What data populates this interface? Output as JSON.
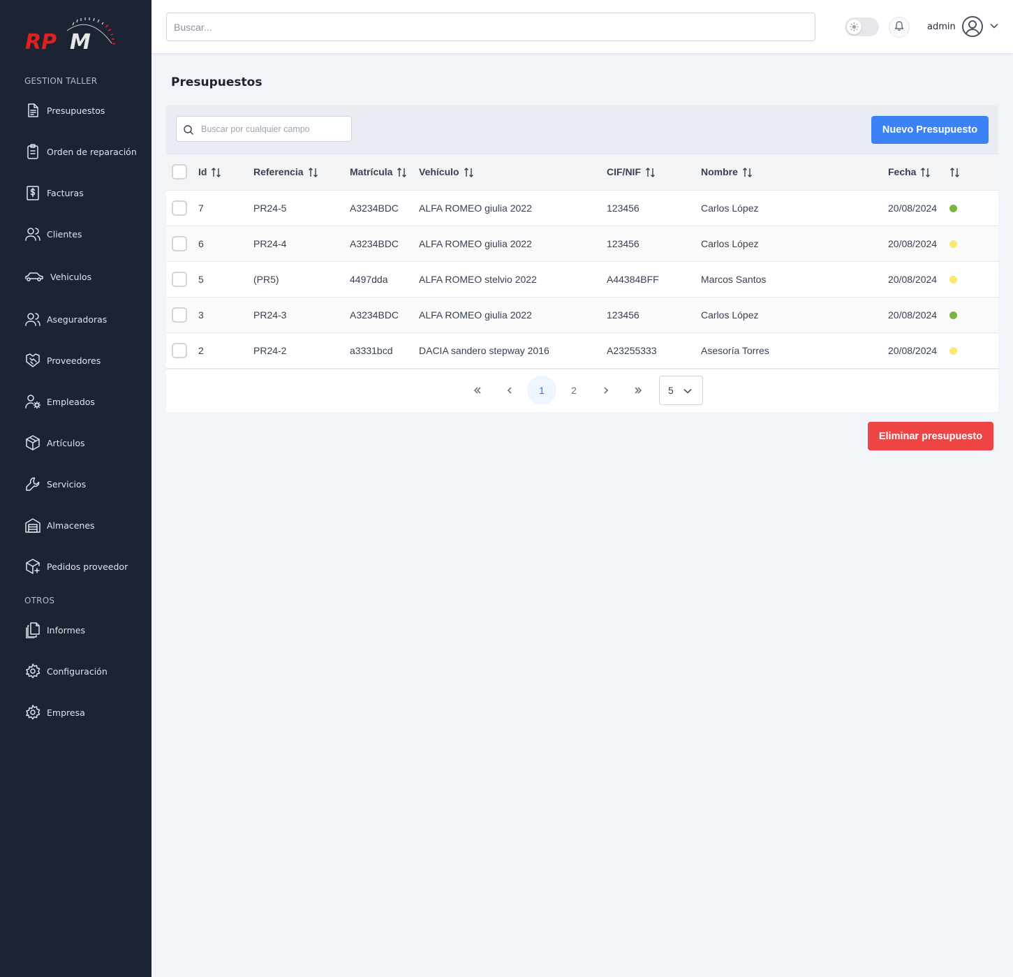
{
  "sidebar": {
    "logo_text": "RPM",
    "sections": [
      {
        "title": "GESTION TALLER",
        "items": [
          {
            "label": "Presupuestos",
            "icon": "document-icon"
          },
          {
            "label": "Orden de reparación",
            "icon": "clipboard-icon"
          },
          {
            "label": "Facturas",
            "icon": "invoice-icon"
          },
          {
            "label": "Clientes",
            "icon": "users-icon"
          },
          {
            "label": "Vehiculos",
            "icon": "car-icon"
          },
          {
            "label": "Aseguradoras",
            "icon": "users-icon"
          },
          {
            "label": "Proveedores",
            "icon": "handshake-icon"
          },
          {
            "label": "Empleados",
            "icon": "user-gear-icon"
          },
          {
            "label": "Artículos",
            "icon": "box-icon"
          },
          {
            "label": "Servicios",
            "icon": "wrench-icon"
          },
          {
            "label": "Almacenes",
            "icon": "warehouse-icon"
          },
          {
            "label": "Pedidos proveedor",
            "icon": "package-add-icon"
          }
        ]
      },
      {
        "title": "OTROS",
        "items": [
          {
            "label": "Informes",
            "icon": "reports-icon"
          },
          {
            "label": "Configuración",
            "icon": "gear-icon"
          },
          {
            "label": "Empresa",
            "icon": "gear-icon"
          }
        ]
      }
    ]
  },
  "header": {
    "search_placeholder": "Buscar...",
    "user_name": "admin"
  },
  "page": {
    "title": "Presupuestos",
    "filter_placeholder": "Buscar por cualquier campo",
    "new_button": "Nuevo Presupuesto",
    "delete_button": "Eliminar presupuesto"
  },
  "table": {
    "columns": [
      "Id",
      "Referencia",
      "Matrícula",
      "Vehículo",
      "CIF/NIF",
      "Nombre",
      "Fecha",
      ""
    ],
    "rows": [
      {
        "id": "7",
        "ref": "PR24-5",
        "plate": "A3234BDC",
        "vehicle": "ALFA ROMEO giulia 2022",
        "cif": "123456",
        "name": "Carlos López",
        "date": "20/08/2024",
        "status_color": "#7cb342"
      },
      {
        "id": "6",
        "ref": "PR24-4",
        "plate": "A3234BDC",
        "vehicle": "ALFA ROMEO giulia 2022",
        "cif": "123456",
        "name": "Carlos López",
        "date": "20/08/2024",
        "status_color": "#fbe870"
      },
      {
        "id": "5",
        "ref": "(PR5)",
        "plate": "4497dda",
        "vehicle": "ALFA ROMEO stelvio 2022",
        "cif": "A44384BFF",
        "name": "Marcos Santos",
        "date": "20/08/2024",
        "status_color": "#fbe870"
      },
      {
        "id": "3",
        "ref": "PR24-3",
        "plate": "A3234BDC",
        "vehicle": "ALFA ROMEO giulia 2022",
        "cif": "123456",
        "name": "Carlos López",
        "date": "20/08/2024",
        "status_color": "#7cb342"
      },
      {
        "id": "2",
        "ref": "PR24-2",
        "plate": "a3331bcd",
        "vehicle": "DACIA sandero stepway 2016",
        "cif": "A23255333",
        "name": "Asesoría Torres",
        "date": "20/08/2024",
        "status_color": "#fbe870"
      }
    ]
  },
  "pagination": {
    "pages": [
      "1",
      "2"
    ],
    "current_page": "1",
    "rows_per_page": "5"
  },
  "colors": {
    "sidebar_bg": "#1c2434",
    "primary": "#3b82f6",
    "danger": "#ef4444",
    "logo_red": "#e0201f"
  }
}
